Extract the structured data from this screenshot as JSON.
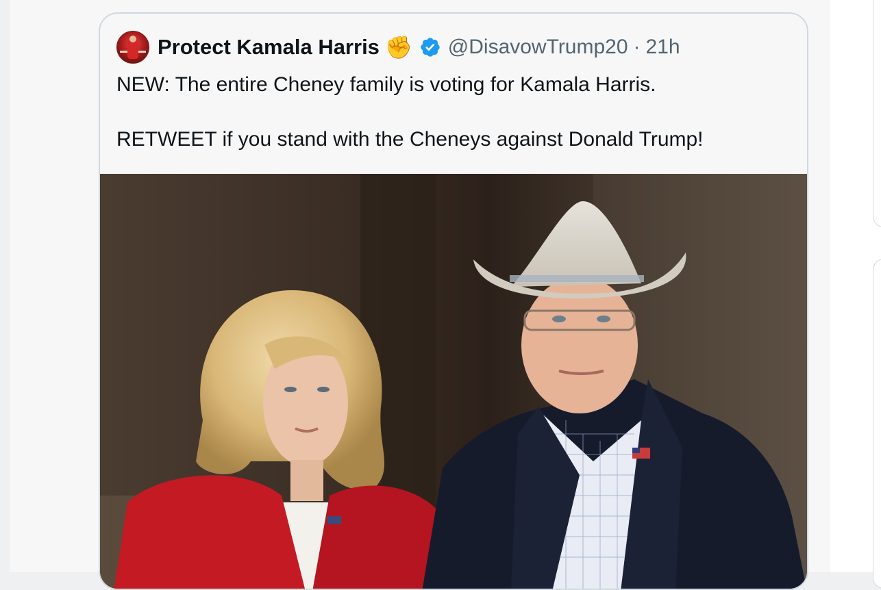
{
  "tweet": {
    "display_name": "Protect Kamala Harris",
    "handle": "@DisavowTrump20",
    "separator": "·",
    "time": "21h",
    "emoji": "✊",
    "text_line_1": "NEW: The entire Cheney family is voting for Kamala Harris.",
    "text_line_2": "RETWEET if you stand with the Cheneys against Donald Trump!"
  },
  "icons": {
    "avatar": "avatar-icon",
    "verified": "verified-badge-icon",
    "emoji": "raised-fist-icon"
  },
  "colors": {
    "verified_blue": "#1d9bf0",
    "text_primary": "#0f1419",
    "text_secondary": "#536471",
    "card_border": "#cfd9de",
    "red_blazer": "#c41a24",
    "navy_jacket": "#161b2c",
    "hat": "#d9d5cc"
  }
}
